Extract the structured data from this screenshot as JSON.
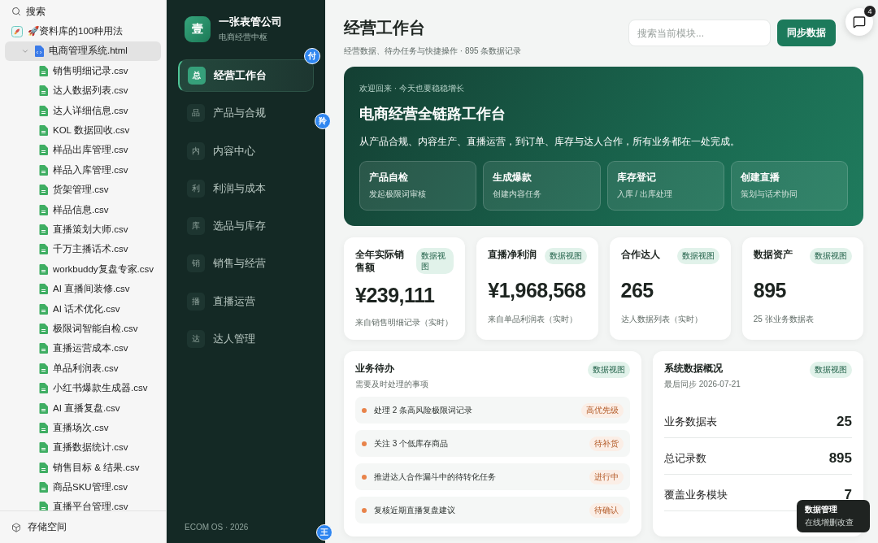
{
  "file_panel": {
    "search_label": "搜索",
    "root": {
      "label": "🚀资料库的100种用法",
      "children": [
        {
          "kind": "html",
          "label": "电商管理系统.html",
          "selected": true,
          "expanded": true,
          "children": [
            {
              "kind": "csv",
              "label": "销售明细记录.csv"
            },
            {
              "kind": "csv",
              "label": "达人数据列表.csv"
            },
            {
              "kind": "csv",
              "label": "达人详细信息.csv"
            },
            {
              "kind": "csv",
              "label": "KOL 数据回收.csv"
            },
            {
              "kind": "csv",
              "label": "样品出库管理.csv"
            },
            {
              "kind": "csv",
              "label": "样品入库管理.csv"
            },
            {
              "kind": "csv",
              "label": "货架管理.csv"
            },
            {
              "kind": "csv",
              "label": "样品信息.csv"
            },
            {
              "kind": "csv",
              "label": "直播策划大师.csv"
            },
            {
              "kind": "csv",
              "label": "千万主播话术.csv"
            },
            {
              "kind": "csv",
              "label": "workbuddy复盘专家.csv"
            },
            {
              "kind": "csv",
              "label": "AI 直播间装修.csv"
            },
            {
              "kind": "csv",
              "label": "AI 话术优化.csv"
            },
            {
              "kind": "csv",
              "label": "极限词智能自检.csv"
            },
            {
              "kind": "csv",
              "label": "直播运营成本.csv"
            },
            {
              "kind": "csv",
              "label": "单品利润表.csv"
            },
            {
              "kind": "csv",
              "label": "小红书爆款生成器.csv"
            },
            {
              "kind": "csv",
              "label": "AI 直播复盘.csv"
            },
            {
              "kind": "csv",
              "label": "直播场次.csv"
            },
            {
              "kind": "csv",
              "label": "直播数据统计.csv"
            },
            {
              "kind": "csv",
              "label": "销售目标 & 结果.csv"
            },
            {
              "kind": "csv",
              "label": "商品SKU管理.csv"
            },
            {
              "kind": "csv",
              "label": "直播平台管理.csv"
            }
          ]
        }
      ]
    },
    "footer": "存储空间"
  },
  "nav": {
    "brand": {
      "logo": "壹",
      "name": "一张表管公司",
      "subtitle": "电商经营中枢"
    },
    "items": [
      {
        "icon": "总",
        "label": "经营工作台",
        "selected": true
      },
      {
        "icon": "品",
        "label": "产品与合规",
        "selected": false
      },
      {
        "icon": "内",
        "label": "内容中心",
        "selected": false
      },
      {
        "icon": "利",
        "label": "利润与成本",
        "selected": false
      },
      {
        "icon": "库",
        "label": "选品与库存",
        "selected": false
      },
      {
        "icon": "销",
        "label": "销售与经营",
        "selected": false
      },
      {
        "icon": "播",
        "label": "直播运营",
        "selected": false
      },
      {
        "icon": "达",
        "label": "达人管理",
        "selected": false
      }
    ],
    "footer": "ECOM OS · 2026"
  },
  "avatars": [
    "付",
    "羚",
    "王"
  ],
  "header": {
    "title": "经营工作台",
    "subtitle": "经营数据、待办任务与快捷操作 · 895 条数据记录",
    "search_placeholder": "搜索当前模块...",
    "sync_button": "同步数据"
  },
  "chat_bubble": {
    "count": "4"
  },
  "hero": {
    "eyebrow": "欢迎回来 · 今天也要稳稳增长",
    "title": "电商经营全链路工作台",
    "description": "从产品合规、内容生产、直播运营，到订单、库存与达人合作，所有业务都在一处完成。",
    "actions": [
      {
        "title": "产品自检",
        "subtitle": "发起极限词审核"
      },
      {
        "title": "生成爆款",
        "subtitle": "创建内容任务"
      },
      {
        "title": "库存登记",
        "subtitle": "入库 / 出库处理"
      },
      {
        "title": "创建直播",
        "subtitle": "策划与话术协同"
      }
    ]
  },
  "stats": [
    {
      "title": "全年实际销售额",
      "tag": "数据视图",
      "value": "¥239,111",
      "note": "来自销售明细记录（实时）"
    },
    {
      "title": "直播净利润",
      "tag": "数据视图",
      "value": "¥1,968,568",
      "note": "来自单品利润表（实时）"
    },
    {
      "title": "合作达人",
      "tag": "数据视图",
      "value": "265",
      "note": "达人数据列表（实时）"
    },
    {
      "title": "数据资产",
      "tag": "数据视图",
      "value": "895",
      "note": "25 张业务数据表"
    }
  ],
  "todo": {
    "title": "业务待办",
    "subtitle": "需要及时处理的事项",
    "tag": "数据视图",
    "items": [
      {
        "text": "处理 2 条高风险极限词记录",
        "status": "高优先级",
        "color": "#e8834a"
      },
      {
        "text": "关注 3 个低库存商品",
        "status": "待补货",
        "color": "#e8834a"
      },
      {
        "text": "推进达人合作漏斗中的待转化任务",
        "status": "进行中",
        "color": "#e8834a"
      },
      {
        "text": "复核近期直播复盘建议",
        "status": "待确认",
        "color": "#e8834a"
      }
    ]
  },
  "overview": {
    "title": "系统数据概况",
    "subtitle": "最后同步 2026-07-21",
    "tag": "数据视图",
    "rows": [
      {
        "label": "业务数据表",
        "value": "25"
      },
      {
        "label": "总记录数",
        "value": "895"
      },
      {
        "label": "覆盖业务模块",
        "value": "7"
      }
    ]
  },
  "toast": {
    "title": "数据管理",
    "subtitle": "在线增删改查"
  }
}
